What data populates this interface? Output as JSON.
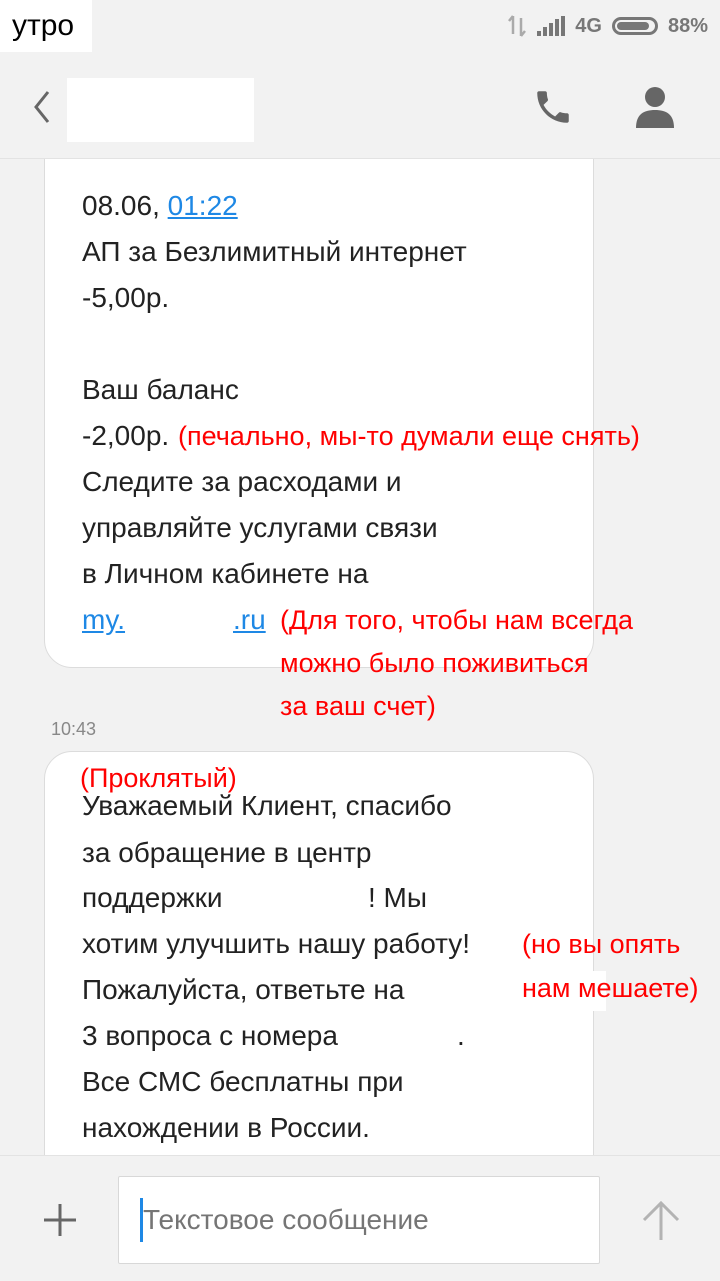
{
  "status_bar": {
    "overlay_label": "утро",
    "network": "4G",
    "battery": "88%"
  },
  "compose": {
    "placeholder": "Текстовое сообщение"
  },
  "messages": {
    "first": {
      "date": "08.06,",
      "time_link": "01:22",
      "lines": [
        "АП за Безлимитный интернет",
        "-5,00р.",
        "Ваш баланс",
        "-2,00р.",
        "Следите за расходами и",
        "управляйте услугами связи",
        "в Личном кабинете на"
      ],
      "link_start": "my.",
      "link_end": ".ru"
    },
    "time": "10:43",
    "second": {
      "lines": [
        "Уважаемый Клиент, спасибо",
        "за обращение в центр",
        "поддержки",
        "! Мы",
        "хотим улучшить нашу работу!",
        "Пожалуйста, ответьте на",
        "3 вопроса с номера",
        ".",
        "Все СМС бесплатны при",
        "нахождении в России."
      ]
    }
  },
  "annotations": {
    "balance_note": "(печально, мы-то думали еще снять)",
    "link_note": [
      "(Для того, чтобы нам всегда",
      "можно было поживиться",
      "за ваш счет)"
    ],
    "cursed_note": "(Проклятый)",
    "improve_note": [
      "(но вы опять",
      "нам мешаете)"
    ]
  }
}
